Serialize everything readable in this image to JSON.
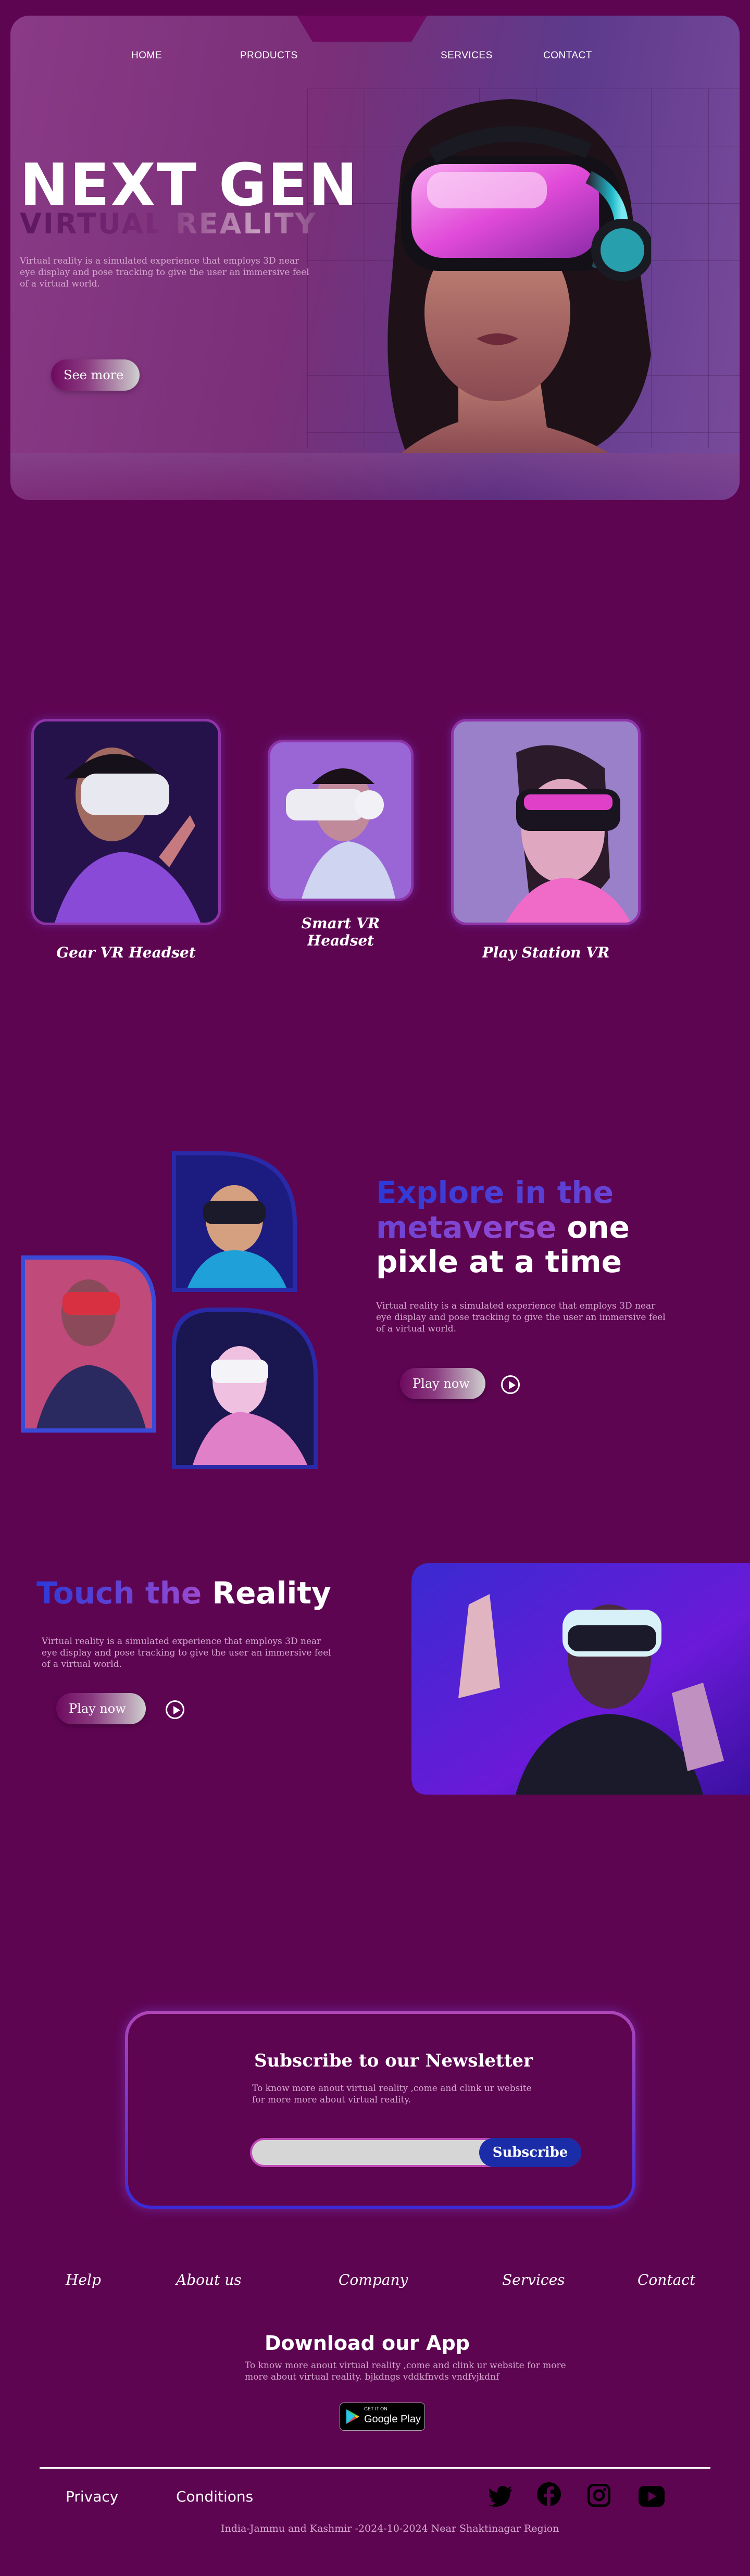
{
  "nav": {
    "items": [
      {
        "label": "HOME"
      },
      {
        "label": "PRODUCTS"
      },
      {
        "label": "SERVICES"
      },
      {
        "label": "CONTACT"
      }
    ]
  },
  "hero": {
    "title": "NEXT GEN",
    "subtitle": "VIRTUAL REALITY",
    "description": "Virtual reality  is a simulated experience that employs 3D near eye display and pose tracking to give the user an immersive feel of a virtual world.",
    "cta_label": "See more"
  },
  "products": [
    {
      "label": "Gear VR Headset"
    },
    {
      "label": "Smart VR Headset"
    },
    {
      "label": "Play Station VR"
    }
  ],
  "metaverse": {
    "title_blue": "Explore in the metaverse",
    "title_white": "one pixle at a time",
    "description": "Virtual reality  is a simulated experience that employs 3D near eye display and pose tracking to give the user an immersive feel of a virtual world.",
    "play_label": "Play now"
  },
  "touch": {
    "title_blue": "Touch the",
    "title_white": "Reality",
    "description": "Virtual reality  is a simulated experience that employs 3D near eye display and pose tracking to give the user an immersive feel of a virtual world.",
    "play_label": "Play now"
  },
  "newsletter": {
    "title": "Subscribe to our Newsletter",
    "description": "To know more anout virtual reality ,come and clink ur website for more more about virtual reality.",
    "input_value": "",
    "button_label": "Subscribe"
  },
  "footer": {
    "links": [
      {
        "label": "Help"
      },
      {
        "label": "About us"
      },
      {
        "label": "Company"
      },
      {
        "label": "Services"
      },
      {
        "label": "Contact"
      }
    ],
    "app_title": "Download  our App",
    "app_description": "To know more anout virtual reality ,come and clink ur website for more more about virtual reality. bjkdngs vddkfnvds vndfvjkdnf",
    "store_small": "GET IT ON",
    "store_label": "Google Play",
    "bottom_links": [
      {
        "label": "Privacy"
      },
      {
        "label": "Conditions"
      }
    ],
    "social_icons": [
      "twitter-icon",
      "facebook-icon",
      "instagram-icon",
      "youtube-icon"
    ],
    "address": "India-Jammu and Kashmir -2024-10-2024 Near Shaktinagar Region"
  },
  "colors": {
    "background": "#5e0552",
    "accent_blue": "#2b3ad8",
    "subscribe_blue": "#1a2ca8",
    "text_pink": "#d6a8cf"
  }
}
